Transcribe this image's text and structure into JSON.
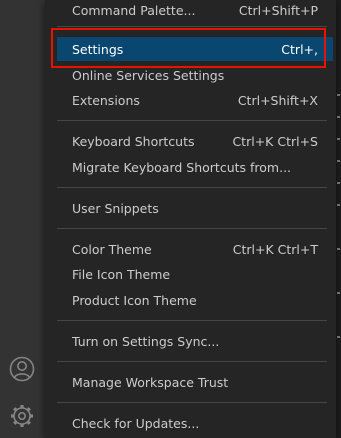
{
  "menu": {
    "items": [
      {
        "label": "Command Palette...",
        "shortcut": "Ctrl+Shift+P"
      },
      {
        "label": "Settings",
        "shortcut": "Ctrl+,"
      },
      {
        "label": "Online Services Settings",
        "shortcut": ""
      },
      {
        "label": "Extensions",
        "shortcut": "Ctrl+Shift+X"
      },
      {
        "label": "Keyboard Shortcuts",
        "shortcut": "Ctrl+K Ctrl+S"
      },
      {
        "label": "Migrate Keyboard Shortcuts from...",
        "shortcut": ""
      },
      {
        "label": "User Snippets",
        "shortcut": ""
      },
      {
        "label": "Color Theme",
        "shortcut": "Ctrl+K Ctrl+T"
      },
      {
        "label": "File Icon Theme",
        "shortcut": ""
      },
      {
        "label": "Product Icon Theme",
        "shortcut": ""
      },
      {
        "label": "Turn on Settings Sync...",
        "shortcut": ""
      },
      {
        "label": "Manage Workspace Trust",
        "shortcut": ""
      },
      {
        "label": "Check for Updates...",
        "shortcut": ""
      }
    ],
    "active_index": 1
  },
  "activity_bar": {
    "icons": [
      "account-icon",
      "manage-gear-icon"
    ]
  },
  "colors": {
    "menu_background": "#252526",
    "active_item_background": "#094771",
    "highlight_outline": "#e51400",
    "separator": "#454545",
    "activity_bar": "#333333"
  }
}
